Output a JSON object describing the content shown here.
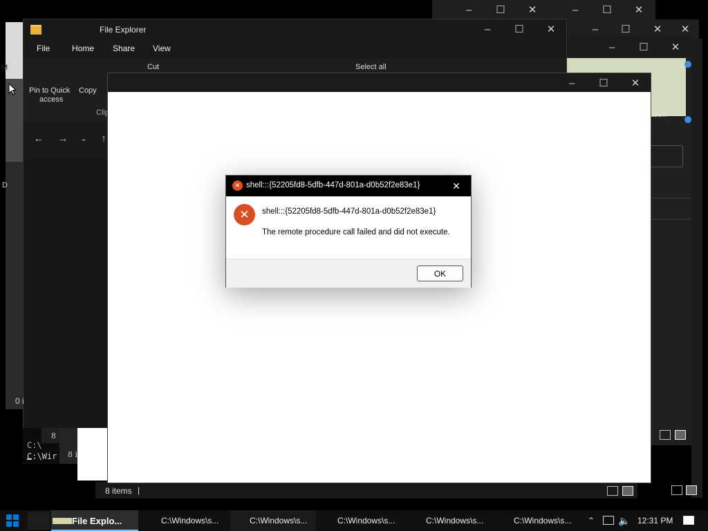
{
  "explorer": {
    "title": "File Explorer",
    "tabs": [
      "File",
      "Home",
      "Share",
      "View"
    ],
    "ribbon": {
      "pin_label_1": "Pin to Quick",
      "pin_label_2": "access",
      "copy_label": "Copy",
      "cut_label": "Cut",
      "select_all_label": "Select all",
      "clipboard_label": "Clip"
    },
    "back_left_count": "0 i",
    "status_count": "8 items",
    "status_sep": "|"
  },
  "terminal": {
    "line1": "C:\\",
    "line2": "C:\\Wir",
    "count1": "8",
    "count2": "8 i"
  },
  "right_window": {
    "partial_text": "ation"
  },
  "left_edge": {
    "m": "M",
    "d": "D"
  },
  "dialog": {
    "title": "shell:::{52205fd8-5dfb-447d-801a-d0b52f2e83e1}",
    "heading": "shell:::{52205fd8-5dfb-447d-801a-d0b52f2e83e1}",
    "message": "The remote procedure call failed and did not execute.",
    "ok_label": "OK",
    "colors": {
      "error": "#d94f23"
    }
  },
  "taskbar": {
    "items": [
      {
        "label": "File Explo..."
      },
      {
        "label": "C:\\Windows\\s..."
      },
      {
        "label": "C:\\Windows\\s..."
      },
      {
        "label": "C:\\Windows\\s..."
      },
      {
        "label": "C:\\Windows\\s..."
      },
      {
        "label": "C:\\Windows\\s..."
      }
    ],
    "clock": "12:31 PM",
    "accent": "#0078d7"
  }
}
